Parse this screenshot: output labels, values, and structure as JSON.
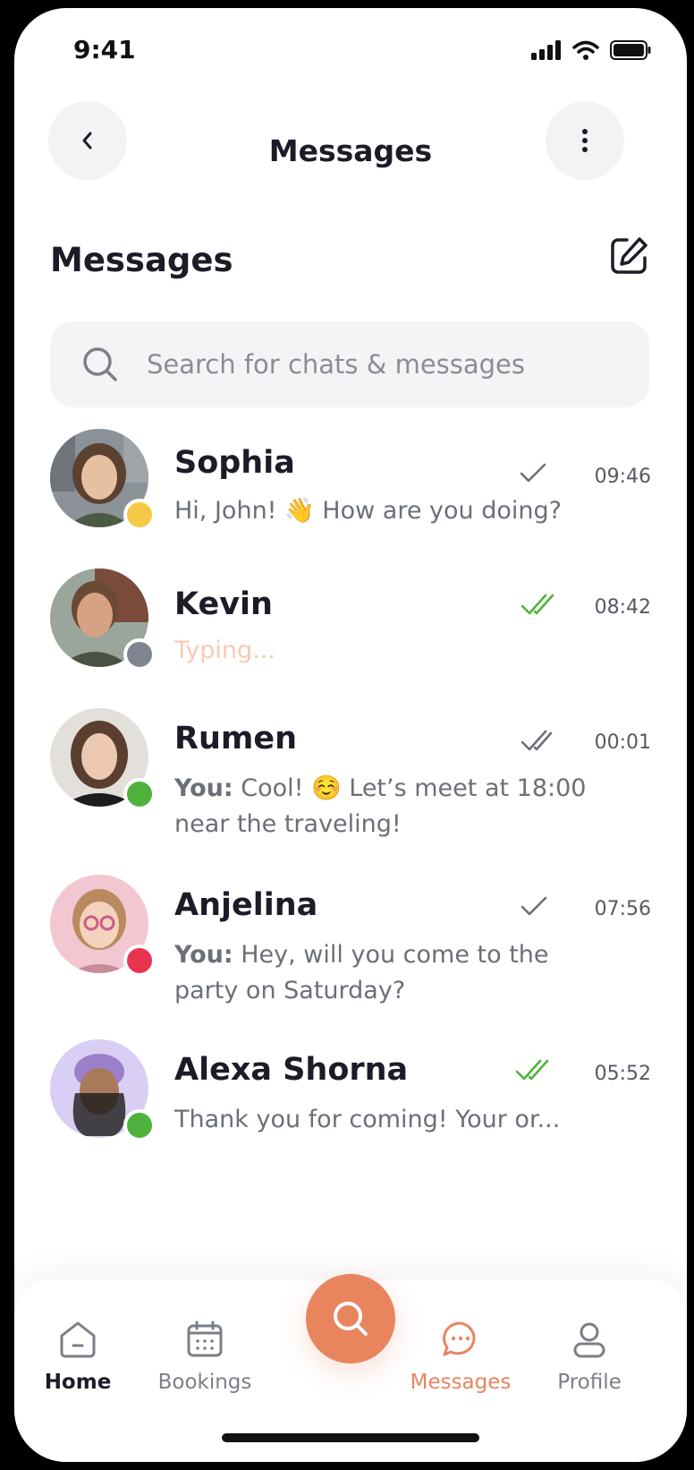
{
  "status_bar": {
    "time": "9:41"
  },
  "header": {
    "title": "Messages"
  },
  "section": {
    "title": "Messages"
  },
  "search": {
    "placeholder": "Search for chats & messages"
  },
  "chats": [
    {
      "name": "Sophia",
      "time": "09:46",
      "read": "sent",
      "status_color": "#f6c945",
      "preview": "Hi, John! 👋 How are you doing?",
      "prefix": ""
    },
    {
      "name": "Kevin",
      "time": "08:42",
      "read": "read",
      "status_color": "#7f8590",
      "preview": "Typing...",
      "prefix": ""
    },
    {
      "name": "Rumen",
      "time": "00:01",
      "read": "delivered",
      "status_color": "#4fb23c",
      "preview": "Cool! ☺️ Let’s meet at 18:00 near the traveling!",
      "prefix": "You:"
    },
    {
      "name": "Anjelina",
      "time": "07:56",
      "read": "sent",
      "status_color": "#e8344f",
      "preview": "Hey, will you come to the party on Saturday?",
      "prefix": "You:"
    },
    {
      "name": "Alexa Shorna",
      "time": "05:52",
      "read": "read",
      "status_color": "#4fb23c",
      "preview": "Thank you for coming! Your or...",
      "prefix": ""
    }
  ],
  "nav": {
    "home": "Home",
    "bookings": "Bookings",
    "messages": "Messages",
    "profile": "Profile",
    "active": "messages"
  },
  "colors": {
    "accent": "#e8855f",
    "read_check": "#4fb23c",
    "text_primary": "#1c1c28",
    "text_secondary": "#6b6f78"
  }
}
